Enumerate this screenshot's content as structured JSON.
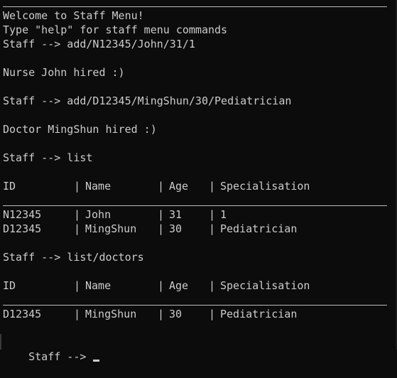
{
  "console": {
    "welcome": "Welcome to Staff Menu!",
    "help_hint": "Type \"help\" for staff menu commands",
    "cmd_add_nurse": "Staff --> add/N12345/John/31/1",
    "msg_nurse_hired": "Nurse John hired :)",
    "cmd_add_doctor": "Staff --> add/D12345/MingShun/30/Pediatrician",
    "msg_doctor_hired": "Doctor MingShun hired :)",
    "cmd_list": "Staff --> list",
    "cmd_list_doctors": "Staff --> list/doctors",
    "prompt": "Staff -->"
  },
  "table_separator": "|",
  "table_headers": [
    "ID",
    "Name",
    "Age",
    "Specialisation"
  ],
  "staff_list": [
    [
      "N12345",
      "John",
      "31",
      "1"
    ],
    [
      "D12345",
      "MingShun",
      "30",
      "Pediatrician"
    ]
  ],
  "doctor_list": [
    [
      "D12345",
      "MingShun",
      "30",
      "Pediatrician"
    ]
  ]
}
